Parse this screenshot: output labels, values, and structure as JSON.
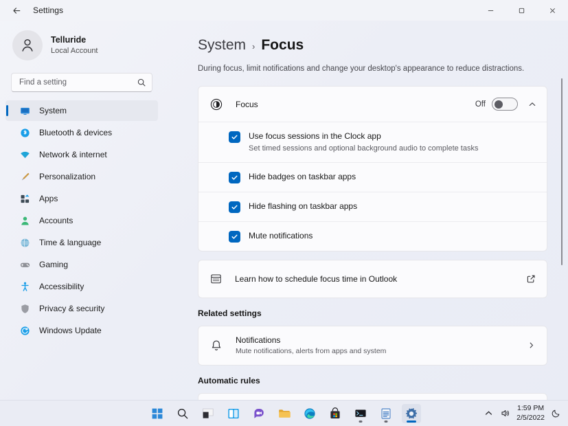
{
  "titlebar": {
    "back_icon": "arrow-left-icon",
    "title": "Settings",
    "minimize": "─",
    "maximize": "☐",
    "close": "✕"
  },
  "profile": {
    "name": "Telluride",
    "account_type": "Local Account",
    "avatar_icon": "person-icon"
  },
  "search": {
    "placeholder": "Find a setting",
    "value": "",
    "icon": "search-icon"
  },
  "sidebar": {
    "items": [
      {
        "label": "System",
        "icon": "monitor-icon",
        "selected": true
      },
      {
        "label": "Bluetooth & devices",
        "icon": "bluetooth-icon",
        "selected": false
      },
      {
        "label": "Network & internet",
        "icon": "wifi-icon",
        "selected": false
      },
      {
        "label": "Personalization",
        "icon": "brush-icon",
        "selected": false
      },
      {
        "label": "Apps",
        "icon": "apps-icon",
        "selected": false
      },
      {
        "label": "Accounts",
        "icon": "account-icon",
        "selected": false
      },
      {
        "label": "Time & language",
        "icon": "globe-icon",
        "selected": false
      },
      {
        "label": "Gaming",
        "icon": "gamepad-icon",
        "selected": false
      },
      {
        "label": "Accessibility",
        "icon": "person-arms-icon",
        "selected": false
      },
      {
        "label": "Privacy & security",
        "icon": "shield-icon",
        "selected": false
      },
      {
        "label": "Windows Update",
        "icon": "update-icon",
        "selected": false
      }
    ]
  },
  "main": {
    "breadcrumb_parent": "System",
    "breadcrumb_separator": "›",
    "breadcrumb_current": "Focus",
    "page_description": "During focus, limit notifications and change your desktop's appearance to reduce distractions.",
    "focus_card": {
      "icon": "focus-icon",
      "title": "Focus",
      "toggle_state": "Off",
      "toggle_on": false,
      "collapse_icon": "chevron-up-icon",
      "options": [
        {
          "label": "Use focus sessions in the Clock app",
          "sublabel": "Set timed sessions and optional background audio to complete tasks",
          "checked": true
        },
        {
          "label": "Hide badges on taskbar apps",
          "sublabel": "",
          "checked": true
        },
        {
          "label": "Hide flashing on taskbar apps",
          "sublabel": "",
          "checked": true
        },
        {
          "label": "Mute notifications",
          "sublabel": "",
          "checked": true
        }
      ]
    },
    "outlook_link": {
      "icon": "calendar-icon",
      "text": "Learn how to schedule focus time in Outlook",
      "external_icon": "external-link-icon"
    },
    "related_settings_heading": "Related settings",
    "notifications_row": {
      "icon": "bell-icon",
      "title": "Notifications",
      "sublabel": "Mute notifications, alerts from apps and system",
      "chevron_icon": "chevron-right-icon"
    },
    "automatic_rules_heading": "Automatic rules"
  },
  "taskbar": {
    "icons": [
      {
        "name": "start-icon",
        "state": "idle"
      },
      {
        "name": "search-icon",
        "state": "idle"
      },
      {
        "name": "task-view-icon",
        "state": "idle"
      },
      {
        "name": "widgets-icon",
        "state": "idle"
      },
      {
        "name": "chat-icon",
        "state": "idle"
      },
      {
        "name": "file-explorer-icon",
        "state": "idle"
      },
      {
        "name": "edge-icon",
        "state": "idle"
      },
      {
        "name": "microsoft-store-icon",
        "state": "idle"
      },
      {
        "name": "terminal-icon",
        "state": "running"
      },
      {
        "name": "notepad-icon",
        "state": "running"
      },
      {
        "name": "settings-icon",
        "state": "active"
      }
    ],
    "tray": {
      "chevron_icon": "chevron-up-icon",
      "volume_icon": "speaker-icon",
      "time": "1:59 PM",
      "date": "2/5/2022",
      "focus_icon": "moon-icon"
    }
  },
  "colors": {
    "accent": "#0067C0",
    "window_bg": "#EEF0F6",
    "card_bg": "#FBFBFD"
  }
}
